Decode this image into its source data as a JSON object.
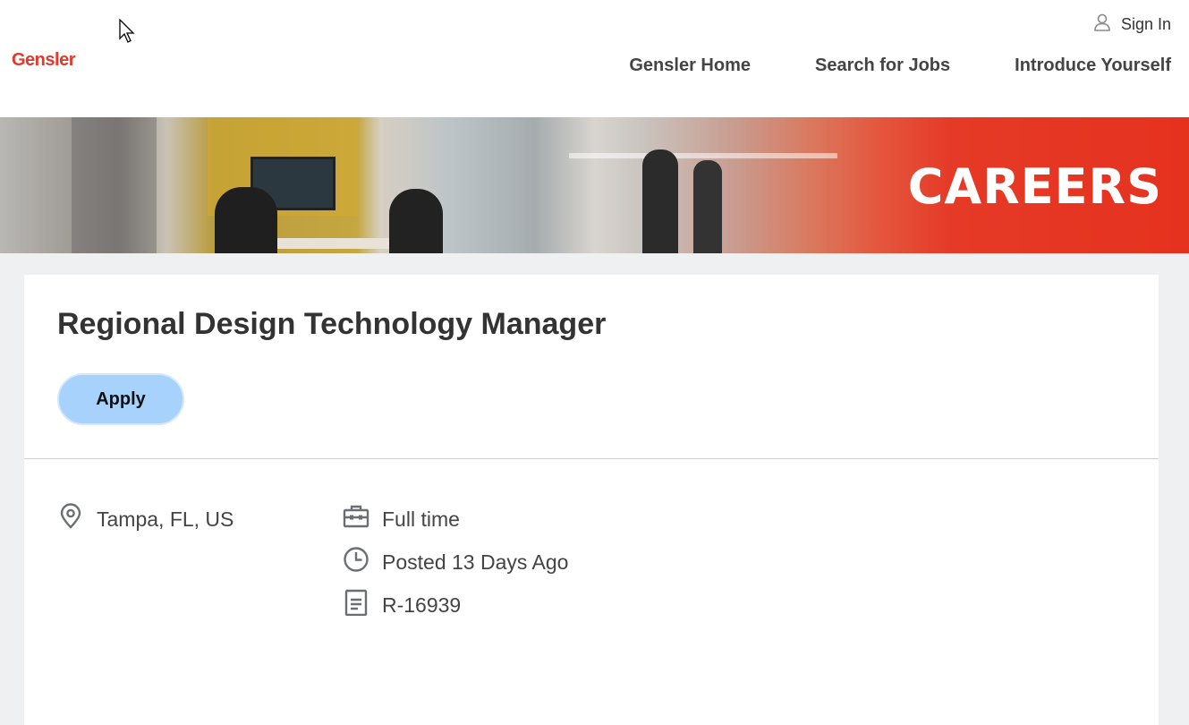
{
  "header": {
    "logo": "Gensler",
    "sign_in": "Sign In",
    "nav": [
      "Gensler Home",
      "Search for Jobs",
      "Introduce Yourself"
    ]
  },
  "banner": {
    "text": "CAREERS"
  },
  "job": {
    "title": "Regional Design Technology Manager",
    "apply_label": "Apply",
    "location": "Tampa, FL, US",
    "time_type": "Full time",
    "posted": "Posted 13 Days Ago",
    "requisition_id": "R-16939"
  },
  "icons": [
    "user-icon",
    "location-pin-icon",
    "briefcase-icon",
    "clock-icon",
    "document-icon",
    "mouse-cursor-icon"
  ],
  "colors": {
    "brand": "#e13a2c",
    "apply_button": "#a6d2fb",
    "page_background": "#eff0f2"
  }
}
